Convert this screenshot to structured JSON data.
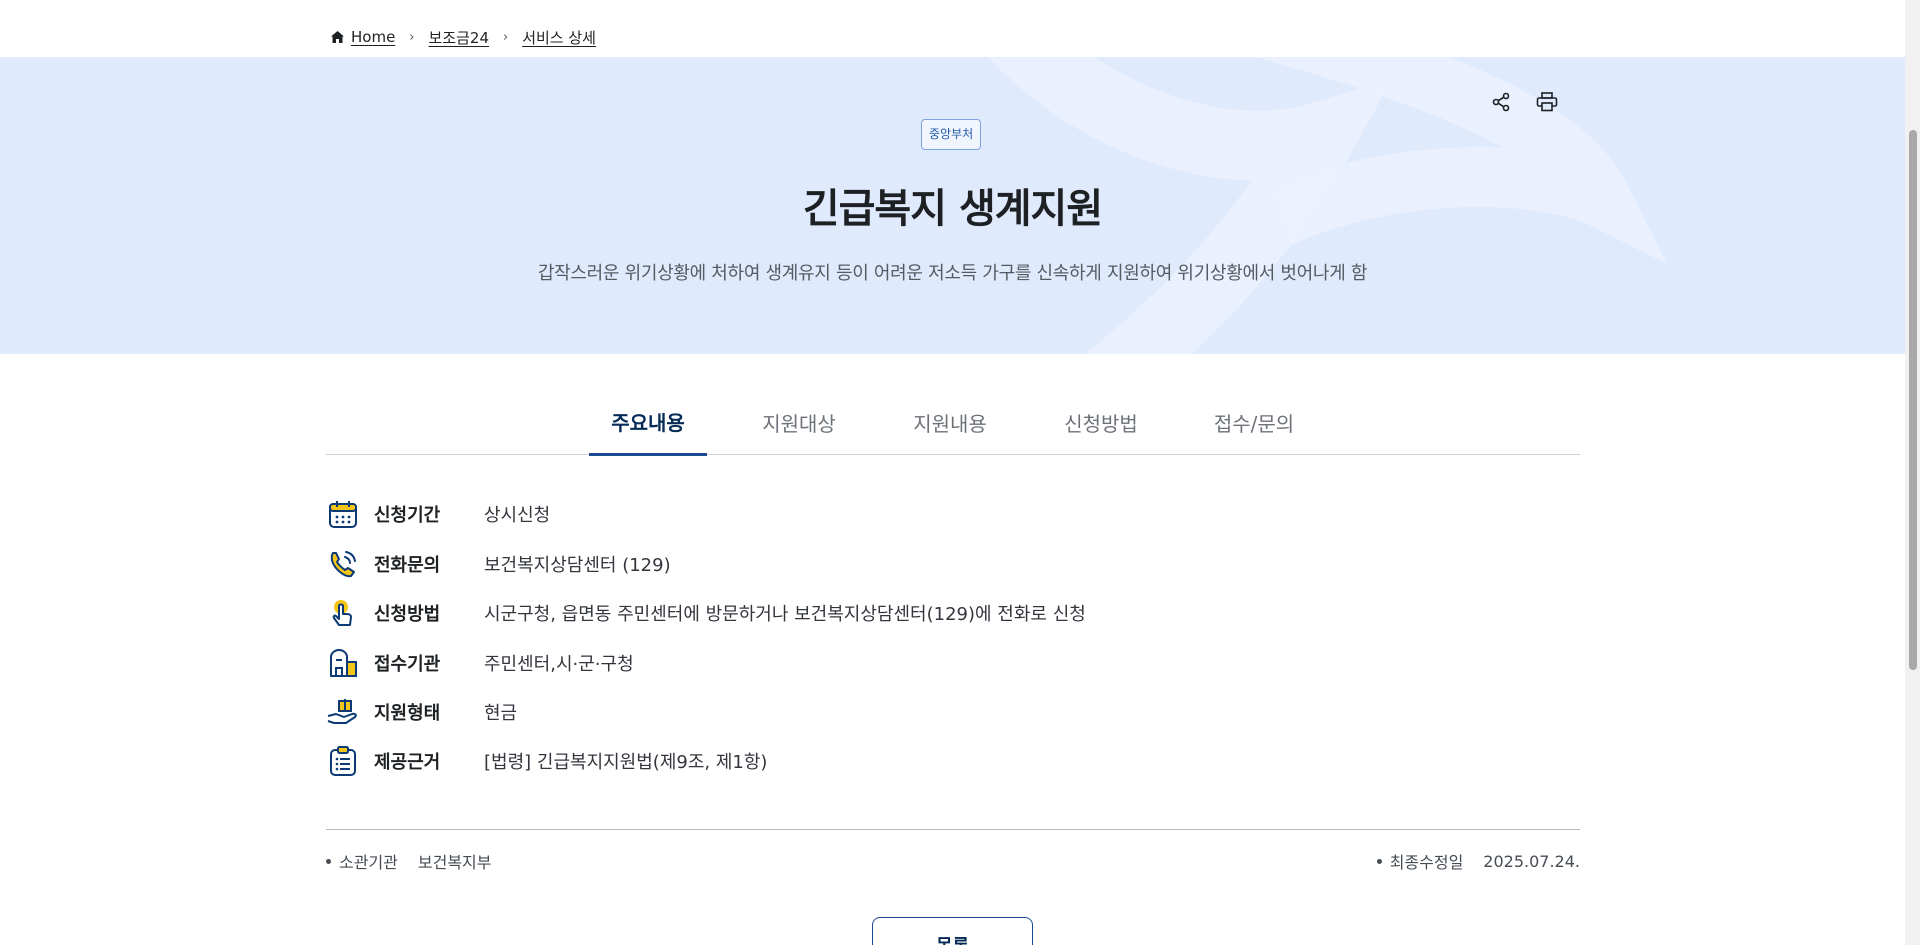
{
  "breadcrumb": {
    "home": "Home",
    "level1": "보조금24",
    "level2": "서비스 상세"
  },
  "hero": {
    "badge": "중앙부처",
    "title": "긴급복지 생계지원",
    "description": "갑작스러운 위기상황에 처하여 생계유지 등이 어려운 저소득 가구를 신속하게 지원하여 위기상황에서 벗어나게 함",
    "share_icon": "share-icon",
    "print_icon": "print-icon"
  },
  "tabs": [
    {
      "label": "주요내용",
      "active": true
    },
    {
      "label": "지원대상",
      "active": false
    },
    {
      "label": "지원내용",
      "active": false
    },
    {
      "label": "신청방법",
      "active": false
    },
    {
      "label": "접수/문의",
      "active": false
    }
  ],
  "info": [
    {
      "icon": "calendar-icon",
      "label": "신청기간",
      "value": "상시신청"
    },
    {
      "icon": "phone-icon",
      "label": "전화문의",
      "value": "보건복지상담센터 (129)"
    },
    {
      "icon": "touch-hand-icon",
      "label": "신청방법",
      "value": "시군구청, 읍면동 주민센터에 방문하거나 보건복지상담센터(129)에 전화로 신청"
    },
    {
      "icon": "building-icon",
      "label": "접수기관",
      "value": "주민센터,시·군·구청"
    },
    {
      "icon": "hand-gift-icon",
      "label": "지원형태",
      "value": "현금"
    },
    {
      "icon": "clipboard-icon",
      "label": "제공근거",
      "value": "[법령] 긴급복지지원법(제9조, 제1항)"
    }
  ],
  "meta": {
    "agency_label": "소관기관",
    "agency_value": "보건복지부",
    "updated_label": "최종수정일",
    "updated_value": "2025.07.24."
  },
  "list_button": "목록",
  "colors": {
    "hero_bg": "#dfeafd",
    "accent": "#1b4a92",
    "icon_yellow": "#f5c518",
    "icon_navy": "#0b3a75"
  }
}
